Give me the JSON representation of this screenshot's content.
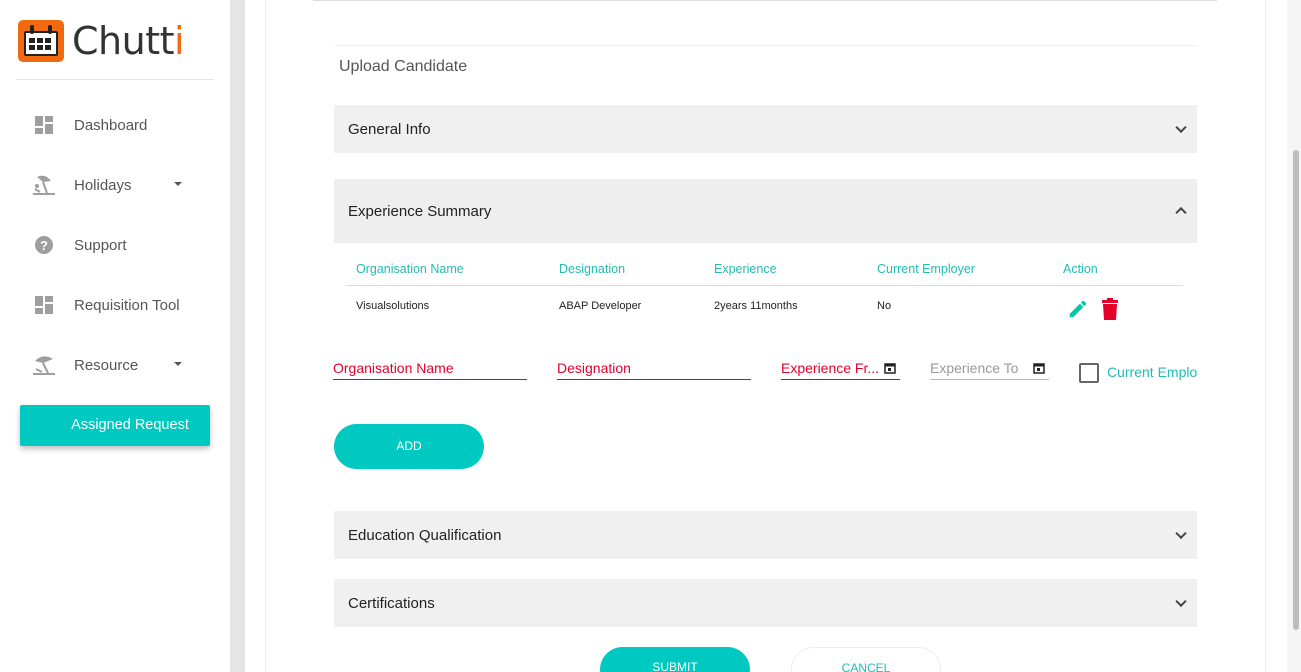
{
  "brand": {
    "name_main": "Chutt",
    "name_last": "i"
  },
  "sidebar": {
    "items": [
      {
        "label": "Dashboard",
        "icon": "dashboard-icon"
      },
      {
        "label": "Holidays",
        "icon": "beach-icon",
        "has_caret": true
      },
      {
        "label": "Support",
        "icon": "help-icon"
      },
      {
        "label": "Requisition Tool",
        "icon": "dashboard-icon"
      },
      {
        "label": "Resource",
        "icon": "beach-icon",
        "has_caret": true
      }
    ],
    "active_button": "Assigned Request"
  },
  "page": {
    "title": "Upload Candidate",
    "panels": {
      "general": "General Info",
      "experience": "Experience Summary",
      "education": "Education Qualification",
      "certifications": "Certifications"
    }
  },
  "experience_table": {
    "headers": [
      "Organisation Name",
      "Designation",
      "Experience",
      "Current Employer",
      "Action"
    ],
    "rows": [
      {
        "org": "Visualsolutions",
        "designation": "ABAP Developer",
        "experience": "2years 11months",
        "current": "No"
      }
    ]
  },
  "form": {
    "org_placeholder": "Organisation Name",
    "designation_placeholder": "Designation",
    "exp_from_placeholder": "Experience Fr...",
    "exp_to_placeholder": "Experience To",
    "current_employer_label": "Current Employer",
    "add_label": "ADD"
  },
  "actions": {
    "submit": "SUBMIT",
    "cancel": "CANCEL"
  },
  "colors": {
    "accent": "#00c9c1",
    "error": "#e4002b",
    "brand_orange": "#f26a0f"
  }
}
